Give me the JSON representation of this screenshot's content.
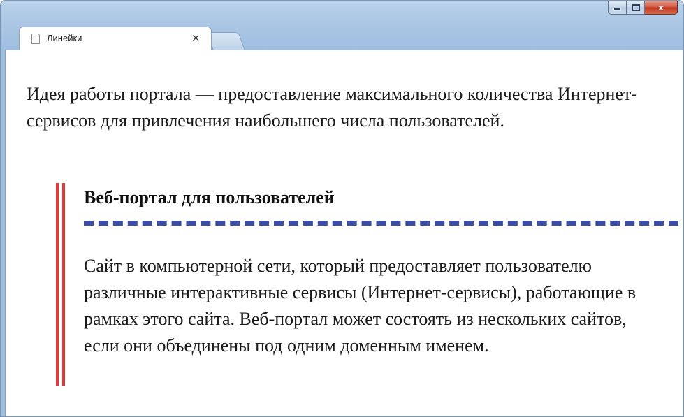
{
  "window": {
    "controls": {
      "minimize_icon": "minimize-icon",
      "maximize_icon": "maximize-icon",
      "close_label": "x"
    }
  },
  "tabs": {
    "active": {
      "title": "Линейки",
      "close_label": "×",
      "icon": "page-icon"
    },
    "new_tab_icon": "new-tab-icon"
  },
  "page": {
    "intro": "Идея работы портала — предоставление максимального количества Интернет-сервисов для привлечения наибольшего числа пользователей.",
    "blockquote": {
      "heading": "Веб-портал для пользователей",
      "body": "Сайт в компьютерной сети, который предоставляет пользователю различные интерактивные сервисы (Интернет-сервисы), работающие в рамках этого сайта. Веб-портал может состоять из нескольких сайтов, если они объединены под одним доменным именем."
    }
  },
  "colors": {
    "left_rule": "#e8393a",
    "dotted_rule": "#3c4da6",
    "window_frame": "#a9c5e3"
  }
}
